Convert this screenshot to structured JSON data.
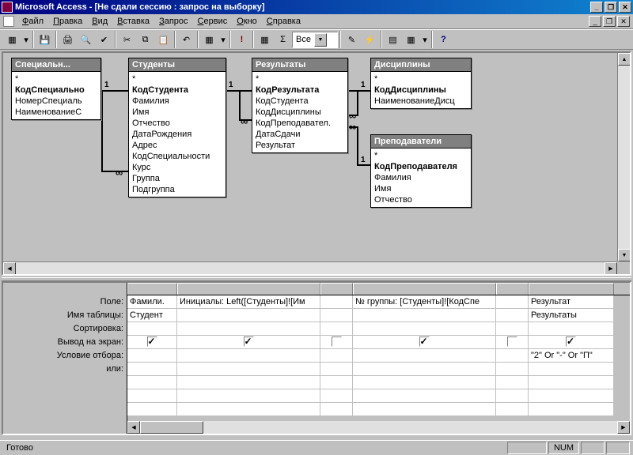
{
  "title": "Microsoft Access - [Не сдали сессию : запрос на выборку]",
  "menu": [
    "Файл",
    "Правка",
    "Вид",
    "Вставка",
    "Запрос",
    "Сервис",
    "Окно",
    "Справка"
  ],
  "toolbar_combo": "Все",
  "tables": {
    "t1": {
      "title": "Специальн...",
      "rows": [
        {
          "t": "*",
          "b": 0
        },
        {
          "t": "КодСпециально",
          "b": 1
        },
        {
          "t": "НомерСпециаль",
          "b": 0
        },
        {
          "t": "НаименованиеС",
          "b": 0
        }
      ]
    },
    "t2": {
      "title": "Студенты",
      "rows": [
        {
          "t": "*",
          "b": 0
        },
        {
          "t": "КодСтудента",
          "b": 1
        },
        {
          "t": "Фамилия",
          "b": 0
        },
        {
          "t": "Имя",
          "b": 0
        },
        {
          "t": "Отчество",
          "b": 0
        },
        {
          "t": "ДатаРождения",
          "b": 0
        },
        {
          "t": "Адрес",
          "b": 0
        },
        {
          "t": "КодСпециальности",
          "b": 0
        },
        {
          "t": "Курс",
          "b": 0
        },
        {
          "t": "Группа",
          "b": 0
        },
        {
          "t": "Подгруппа",
          "b": 0
        }
      ]
    },
    "t3": {
      "title": "Результаты",
      "rows": [
        {
          "t": "*",
          "b": 0
        },
        {
          "t": "КодРезультата",
          "b": 1
        },
        {
          "t": "КодСтудента",
          "b": 0
        },
        {
          "t": "КодДисциплины",
          "b": 0
        },
        {
          "t": "КодПреподавател.",
          "b": 0
        },
        {
          "t": "ДатаСдачи",
          "b": 0
        },
        {
          "t": "Результат",
          "b": 0
        }
      ]
    },
    "t4": {
      "title": "Дисциплины",
      "rows": [
        {
          "t": "*",
          "b": 0
        },
        {
          "t": "КодДисциплины",
          "b": 1
        },
        {
          "t": "НаименованиеДисц",
          "b": 0
        }
      ]
    },
    "t5": {
      "title": "Преподаватели",
      "rows": [
        {
          "t": "*",
          "b": 0
        },
        {
          "t": "КодПреподавателя",
          "b": 1
        },
        {
          "t": "Фамилия",
          "b": 0
        },
        {
          "t": "Имя",
          "b": 0
        },
        {
          "t": "Отчество",
          "b": 0
        }
      ]
    }
  },
  "rel_one": "1",
  "rel_inf": "∞",
  "grid": {
    "rowlabels": [
      "Поле:",
      "Имя таблицы:",
      "Сортировка:",
      "Вывод на экран:",
      "Условие отбора:",
      "или:"
    ],
    "widths": [
      63,
      181,
      41,
      181,
      41,
      108
    ],
    "cols": [
      {
        "field": "Фамили.",
        "table": "Студент",
        "sort": "",
        "show": true,
        "crit": "",
        "or": ""
      },
      {
        "field": "Инициалы: Left([Студенты]![Им",
        "table": "",
        "sort": "",
        "show": true,
        "crit": "",
        "or": ""
      },
      {
        "field": "",
        "table": "",
        "sort": "",
        "show": false,
        "crit": "",
        "or": ""
      },
      {
        "field": "№ группы: [Студенты]![КодСпе",
        "table": "",
        "sort": "",
        "show": true,
        "crit": "",
        "or": ""
      },
      {
        "field": "",
        "table": "",
        "sort": "",
        "show": false,
        "crit": "",
        "or": ""
      },
      {
        "field": "Результат",
        "table": "Результаты",
        "sort": "",
        "show": true,
        "crit": "\"2\" Or \"-\" Or \"П\"",
        "or": ""
      }
    ]
  },
  "status": "Готово",
  "status_num": "NUM"
}
